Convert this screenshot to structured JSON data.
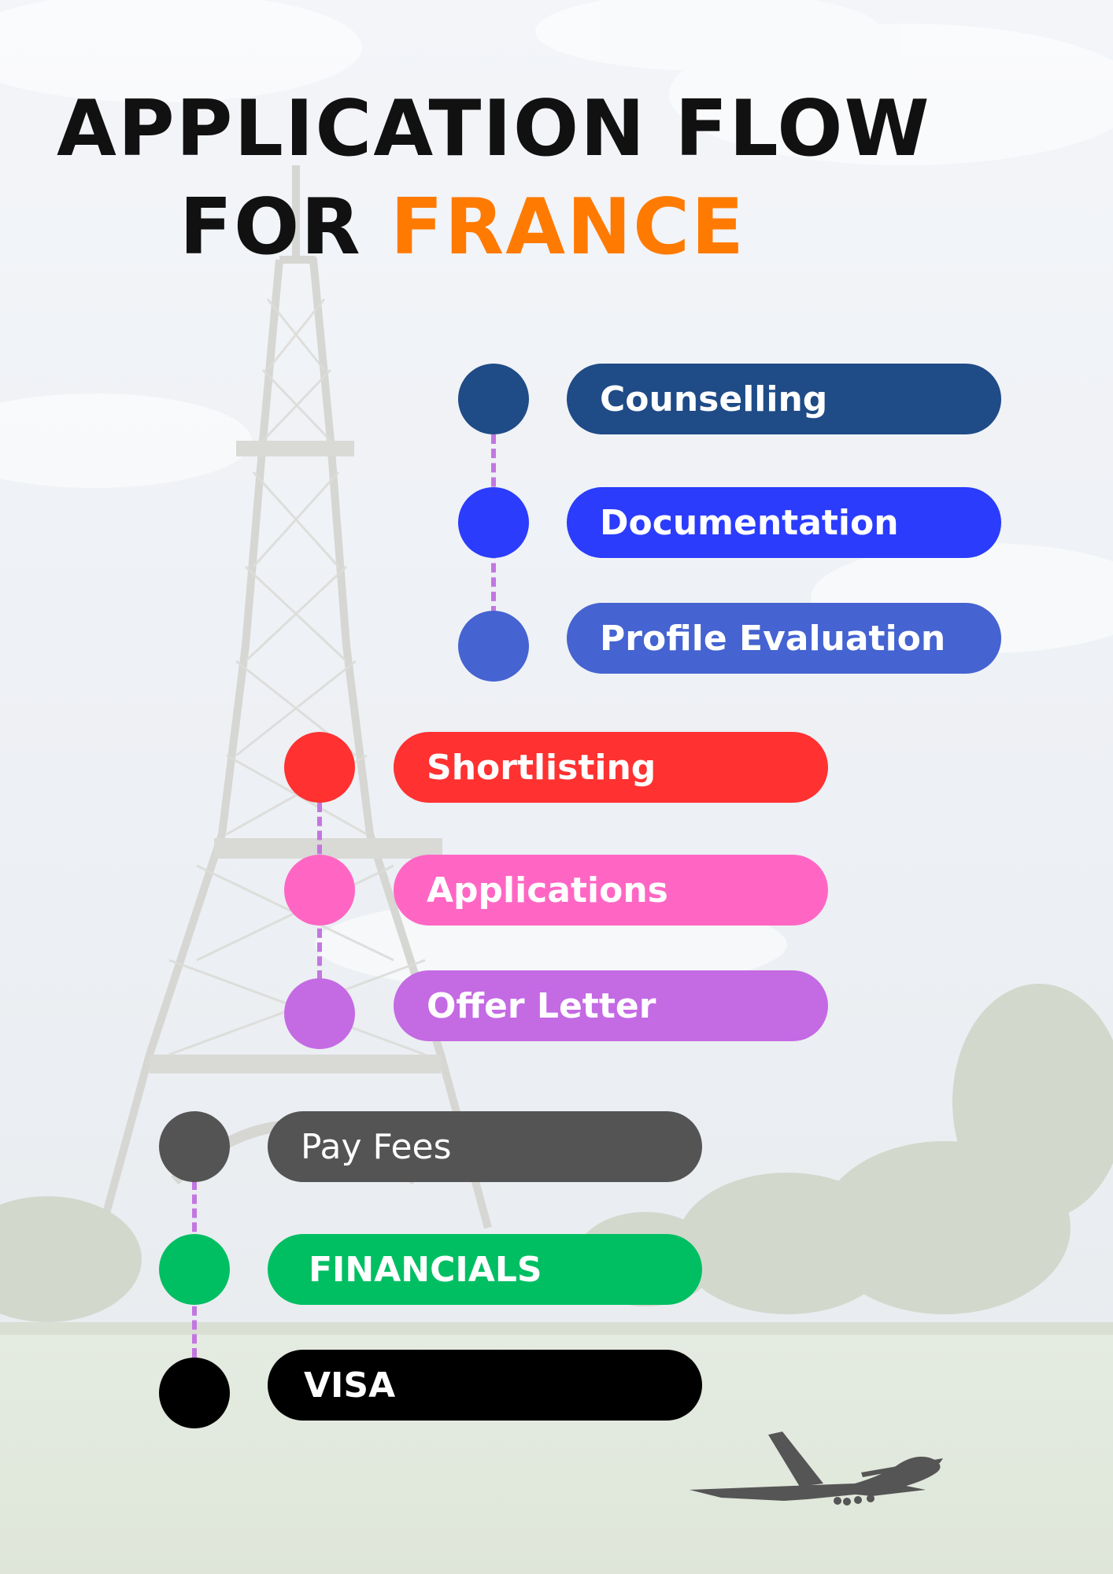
{
  "title": {
    "line1": "APPLICATION FLOW",
    "line2_prefix": "FOR",
    "line2_accent": "FRANCE"
  },
  "colors": {
    "title": "#111111",
    "accent": "#ff7a00",
    "connector": "#c277e0"
  },
  "steps": [
    {
      "label": "Counselling",
      "color": "#1f4b87"
    },
    {
      "label": "Documentation",
      "color": "#2b3cfd"
    },
    {
      "label": "Profile Evaluation",
      "color": "#4563d1"
    },
    {
      "label": "Shortlisting",
      "color": "#ff3131"
    },
    {
      "label": "Applications",
      "color": "#ff66c4"
    },
    {
      "label": "Offer Letter",
      "color": "#c46ae3"
    },
    {
      "label": "Pay Fees",
      "color": "#545454"
    },
    {
      "label": "FINANCIALS",
      "color": "#00bf63"
    },
    {
      "label": "VISA",
      "color": "#000000"
    }
  ],
  "icons": {
    "background": "eiffel-tower-park-photo",
    "plane": "airplane-icon"
  }
}
